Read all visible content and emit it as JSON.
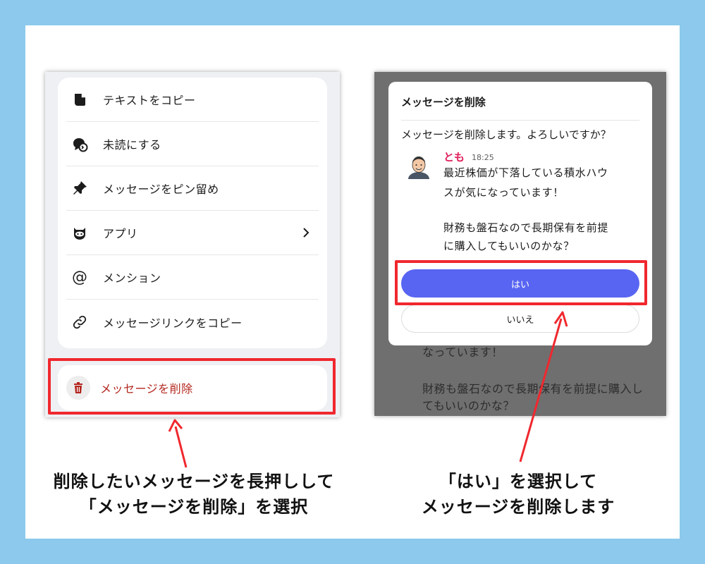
{
  "left_panel": {
    "menu_items": [
      {
        "label": "テキストをコピー",
        "icon": "copy-text-icon"
      },
      {
        "label": "未読にする",
        "icon": "mark-unread-icon"
      },
      {
        "label": "メッセージをピン留め",
        "icon": "pin-icon"
      },
      {
        "label": "アプリ",
        "icon": "app-icon"
      },
      {
        "label": "メンション",
        "icon": "at-sign-icon"
      },
      {
        "label": "メッセージリンクをコピー",
        "icon": "link-icon"
      }
    ],
    "delete_label": "メッセージを削除"
  },
  "right_panel": {
    "dialog_title": "メッセージを削除",
    "dialog_body": "メッセージを削除します。よろしいですか？",
    "message": {
      "author": "とも",
      "time": "18:25",
      "lines": [
        "最近株価が下落している積水ハウ",
        "スが気になっています！",
        "",
        "財務も盤石なので長期保有を前提",
        "に購入してもいいのかな？"
      ]
    },
    "yes_label": "はい",
    "no_label": "いいえ",
    "background_lines": [
      "なっています！",
      "財務も盤石なので長期保有を前提に購入し",
      "てもいいのかな？"
    ]
  },
  "captions": {
    "left_line1": "削除したいメッセージを長押しして",
    "left_line2": "「メッセージを削除」を選択",
    "right_line1": "「はい」を選択して",
    "right_line2": "メッセージを削除します"
  },
  "colors": {
    "background": "#8cc9ec",
    "highlight": "#f0282e",
    "accent_button": "#5865f2",
    "delete_text": "#b3261e",
    "author_name": "#e01e5a"
  }
}
